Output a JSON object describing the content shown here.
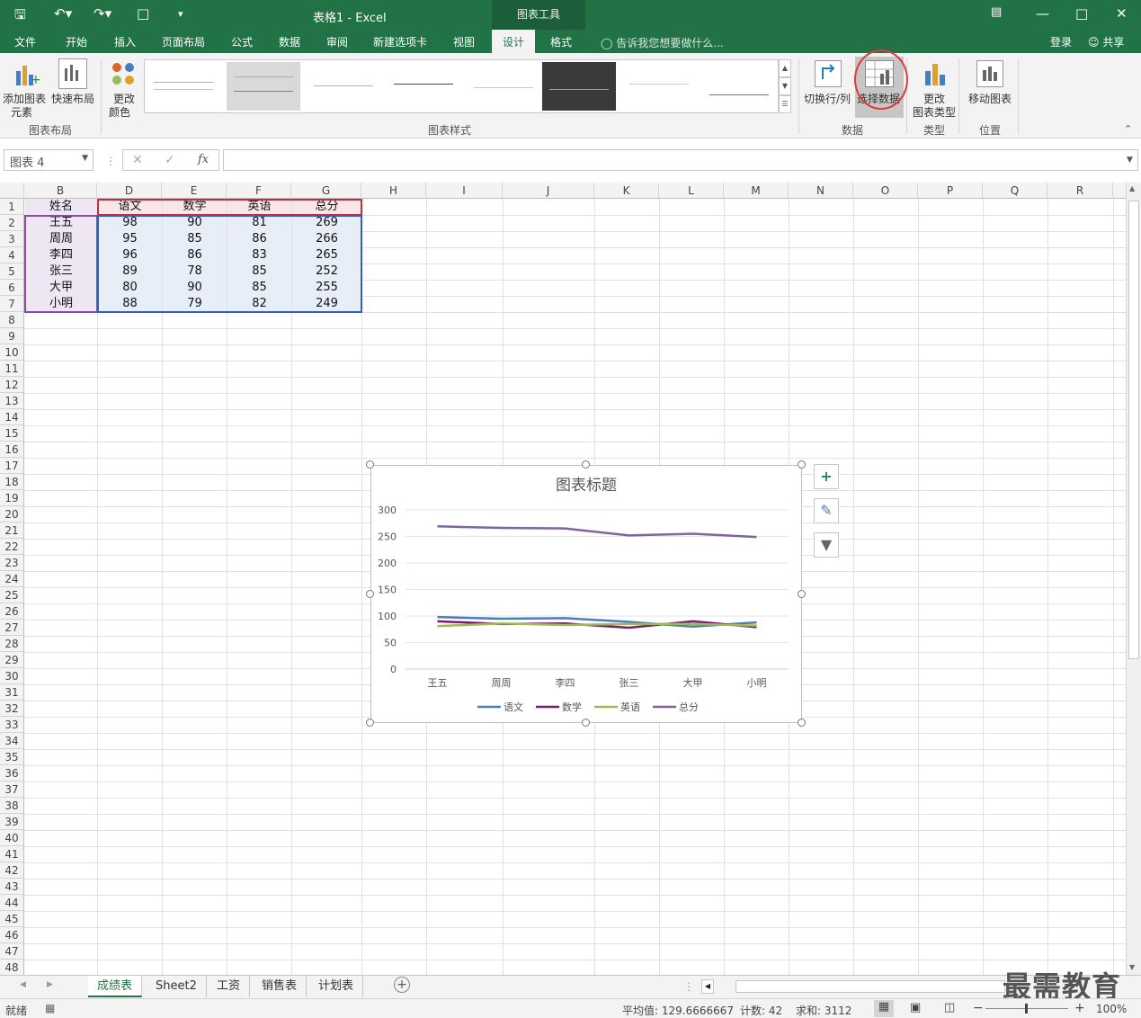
{
  "titlebar": {
    "title": "表格1 - Excel",
    "context_tab": "图表工具"
  },
  "tabs": [
    "文件",
    "开始",
    "插入",
    "页面布局",
    "公式",
    "数据",
    "审阅",
    "新建选项卡",
    "视图",
    "设计",
    "格式"
  ],
  "tellme": "告诉我您想要做什么...",
  "account": {
    "login": "登录",
    "share": "共享"
  },
  "ribbon": {
    "add_element_1": "添加图表",
    "add_element_2": "元素",
    "quick_layout": "快速布局",
    "change_color_1": "更改",
    "change_color_2": "颜色",
    "switch_row_col": "切换行/列",
    "select_data": "选择数据",
    "change_type_1": "更改",
    "change_type_2": "图表类型",
    "move_chart": "移动图表",
    "groups": {
      "layout": "图表布局",
      "styles": "图表样式",
      "data": "数据",
      "type": "类型",
      "location": "位置"
    }
  },
  "formula_bar": {
    "name_box": "图表 4",
    "fx": "fx"
  },
  "columns": [
    "B",
    "D",
    "E",
    "F",
    "G",
    "H",
    "I",
    "J",
    "K",
    "L",
    "M",
    "N",
    "O",
    "P",
    "Q",
    "R"
  ],
  "table": {
    "headers": [
      "姓名",
      "语文",
      "数学",
      "英语",
      "总分"
    ],
    "rows": [
      [
        "王五",
        "98",
        "90",
        "81",
        "269"
      ],
      [
        "周周",
        "95",
        "85",
        "86",
        "266"
      ],
      [
        "李四",
        "96",
        "86",
        "83",
        "265"
      ],
      [
        "张三",
        "89",
        "78",
        "85",
        "252"
      ],
      [
        "大甲",
        "80",
        "90",
        "85",
        "255"
      ],
      [
        "小明",
        "88",
        "79",
        "82",
        "249"
      ]
    ]
  },
  "chart_data": {
    "type": "line",
    "title": "图表标题",
    "categories": [
      "王五",
      "周周",
      "李四",
      "张三",
      "大甲",
      "小明"
    ],
    "ylim": [
      0,
      300
    ],
    "yticks": [
      0,
      50,
      100,
      150,
      200,
      250,
      300
    ],
    "grid": true,
    "legend_position": "bottom",
    "series": [
      {
        "name": "语文",
        "color": "#4a7ebb",
        "values": [
          98,
          95,
          96,
          89,
          80,
          88
        ]
      },
      {
        "name": "数学",
        "color": "#7b1b6a",
        "values": [
          90,
          85,
          86,
          78,
          90,
          79
        ]
      },
      {
        "name": "英语",
        "color": "#9bbb59",
        "values": [
          81,
          86,
          83,
          85,
          85,
          82
        ]
      },
      {
        "name": "总分",
        "color": "#8064a2",
        "values": [
          269,
          266,
          265,
          252,
          255,
          249
        ]
      }
    ]
  },
  "sheets": [
    "成绩表",
    "Sheet2",
    "工资",
    "销售表",
    "计划表"
  ],
  "active_sheet": "成绩表",
  "status": {
    "ready": "就绪",
    "average": "平均值: 129.6666667",
    "count": "计数: 42",
    "sum": "求和: 3112",
    "zoom": "100%"
  },
  "watermark": "最需教育",
  "colors": {
    "excel_green": "#217346",
    "highlight_red": "#e03a3a"
  }
}
